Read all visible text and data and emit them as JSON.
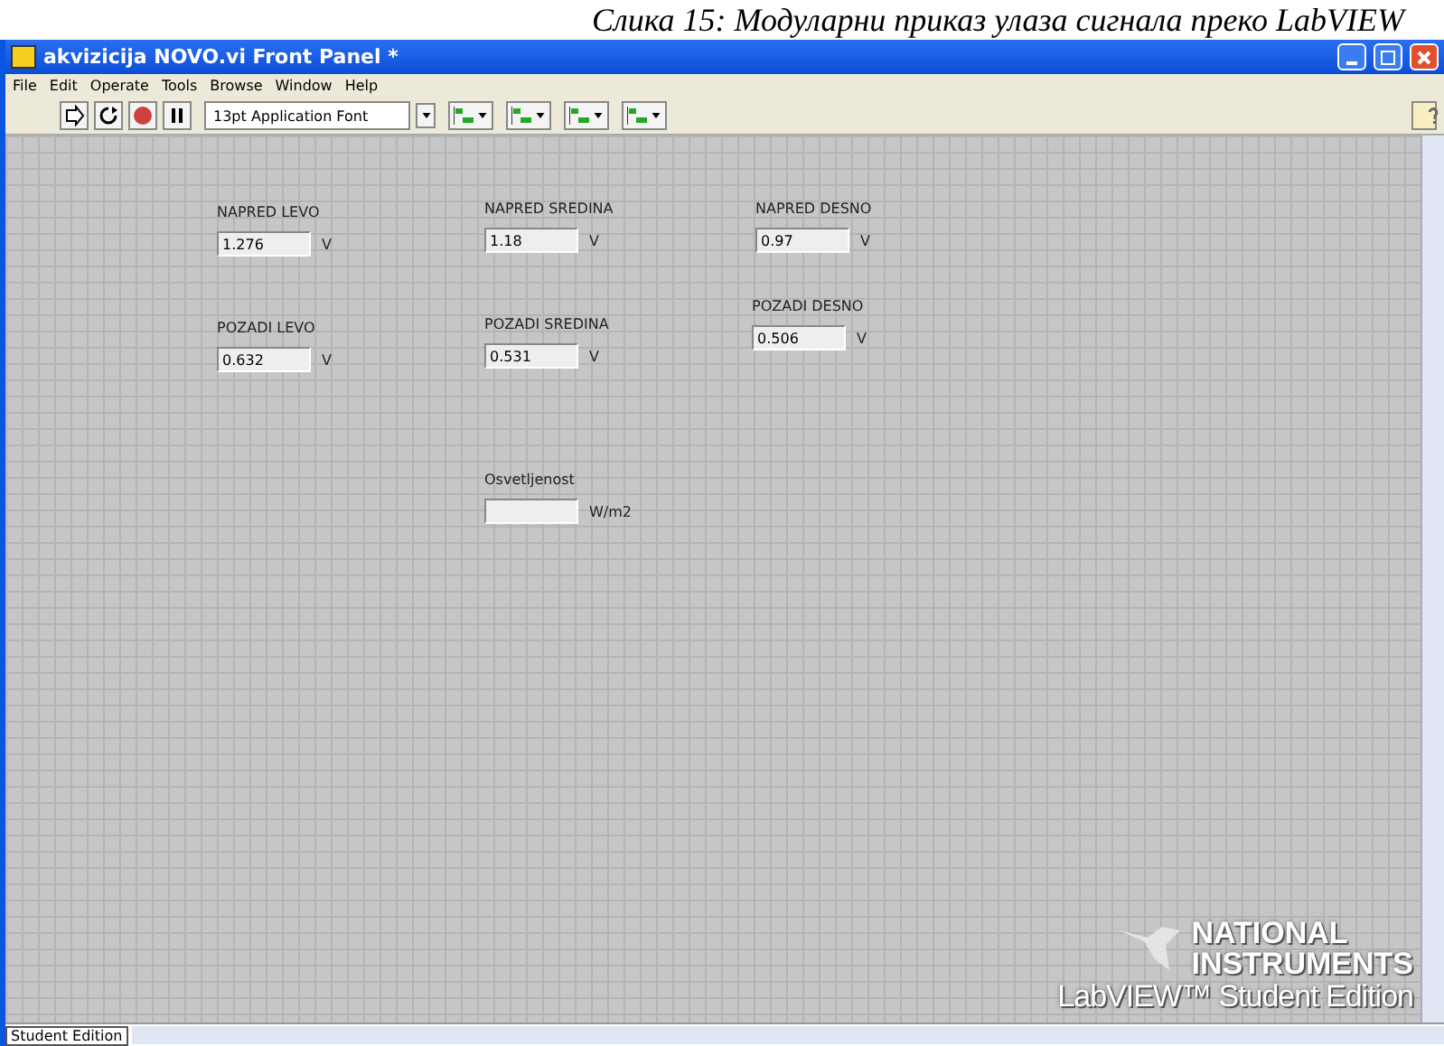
{
  "caption": "Слика 15: Модуларни приказ улаза сигнала преко LabVIEW",
  "window": {
    "title": "akvizicija NOVO.vi Front Panel *"
  },
  "menu": [
    "File",
    "Edit",
    "Operate",
    "Tools",
    "Browse",
    "Window",
    "Help"
  ],
  "toolbar": {
    "font": "13pt Application Font"
  },
  "indicators": [
    {
      "label": "NAPRED LEVO",
      "value": "1.276",
      "unit": "V"
    },
    {
      "label": "NAPRED SREDINA",
      "value": "1.18",
      "unit": "V"
    },
    {
      "label": "NAPRED DESNO",
      "value": "0.97",
      "unit": "V"
    },
    {
      "label": "POZADI LEVO",
      "value": "0.632",
      "unit": "V"
    },
    {
      "label": "POZADI SREDINA",
      "value": "0.531",
      "unit": "V"
    },
    {
      "label": "POZADI DESNO",
      "value": "0.506",
      "unit": "V"
    },
    {
      "label": "Osvetljenost",
      "unit": "W/m2"
    }
  ],
  "logo": [
    "NATIONAL",
    "INSTRUMENTS",
    "LabVIEW™ Student Edition"
  ],
  "status_bar": {
    "label": "Student Edition"
  }
}
